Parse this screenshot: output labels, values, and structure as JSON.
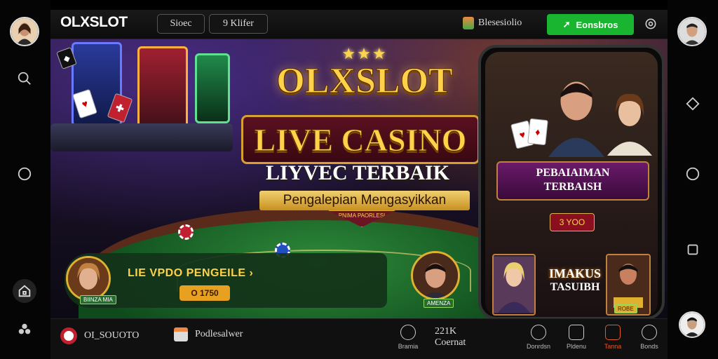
{
  "header": {
    "logo": "OLXSLOT",
    "btn_one": "Sioec",
    "btn_two": "9 Klifer",
    "account_label": "Blesesiolio",
    "register_label": "Eonsbros"
  },
  "hero": {
    "stars": "★★★",
    "brand": "OLXSLOT",
    "main_title": "LIVE CASINO",
    "sub_title": "LIYVEC TERBAIK",
    "tagline": "Pengalepian Mengasyikkan",
    "ribbon": "PNIMA PAORLESI"
  },
  "promo": {
    "text": "LIE VPDO PENGEILE ›",
    "button": "O 1750",
    "badge_left": "BIINZA MIA",
    "badge_right": "AMENZA"
  },
  "phone": {
    "card_line1": "PEBAIAIMAN",
    "card_line2": "TERBAISH",
    "button": "3 YOO",
    "mid_line1": "IMAKUS",
    "mid_line2": "TASUIBH",
    "thumb_badge": "ROBE"
  },
  "bottom": {
    "brand_label": "OI_SOUOTO",
    "item_label": "Podlesalwer",
    "center_line1": "221K",
    "center_line2": "Coernat",
    "center_icon_label": "Bramia",
    "nav": [
      {
        "label": "Donrdsn"
      },
      {
        "label": "Pldenu"
      },
      {
        "label": "Tanna"
      },
      {
        "label": "Bonds"
      }
    ]
  }
}
